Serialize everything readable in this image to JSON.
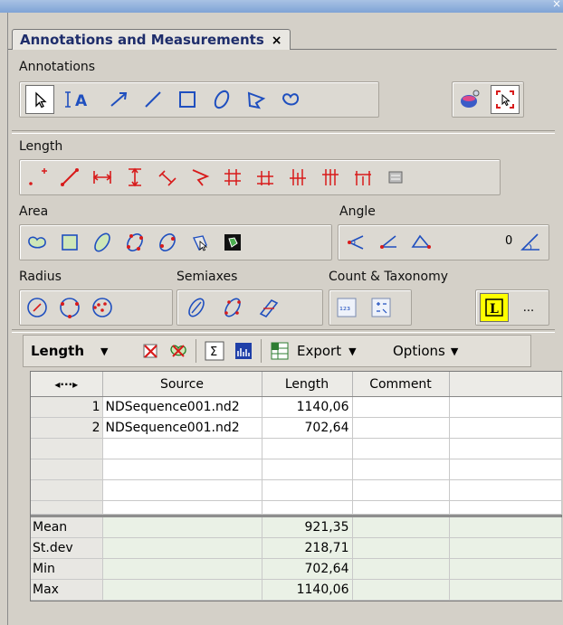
{
  "window": {
    "close_glyph": "×"
  },
  "tab": {
    "title": "Annotations and Measurements",
    "close": "×"
  },
  "sections": {
    "annotations": "Annotations",
    "length": "Length",
    "area": "Area",
    "angle": "Angle",
    "radius": "Radius",
    "semiaxes": "Semiaxes",
    "count": "Count & Taxonomy"
  },
  "tools": {
    "text_tool_label": "A",
    "angle_value": "0",
    "more_button": "..."
  },
  "toolbar": {
    "measure_dropdown": "Length",
    "export_label": "Export",
    "options_label": "Options"
  },
  "table": {
    "corner_label": "◂···▸",
    "columns": [
      "Source",
      "Length",
      "Comment",
      ""
    ],
    "rows": [
      {
        "index": "1",
        "source": "NDSequence001.nd2",
        "length": "1140,06",
        "comment": ""
      },
      {
        "index": "2",
        "source": "NDSequence001.nd2",
        "length": "702,64",
        "comment": ""
      }
    ],
    "stats": [
      {
        "label": "Mean",
        "value": "921,35"
      },
      {
        "label": "St.dev",
        "value": "218,71"
      },
      {
        "label": "Min",
        "value": "702,64"
      },
      {
        "label": "Max",
        "value": "1140,06"
      }
    ]
  },
  "colors": {
    "accent_blue": "#1f4fbf",
    "marker_red": "#d81b1b",
    "stat_bg": "#eaf1e6",
    "panel_bg": "#d4d0c8"
  }
}
